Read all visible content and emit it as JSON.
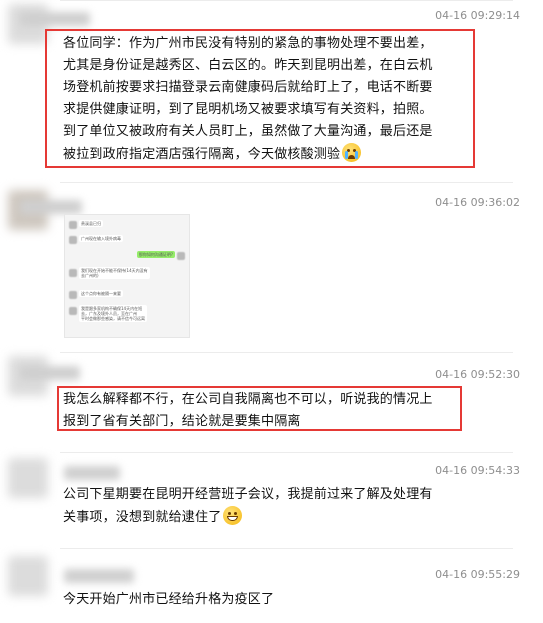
{
  "colors": {
    "highlight_border": "#e53935",
    "timestamp": "#8e8e8e",
    "text": "#111111"
  },
  "messages": [
    {
      "time": "04-16 09:29:14",
      "lines": [
        "各位同学：作为广州市民没有特别的紧急的事物处理不要出差，",
        "尤其是身份证是越秀区、白云区的。昨天到昆明出差，在白云机",
        "场登机前按要求扫描登录云南健康码后就给盯上了，电话不断要",
        "求提供健康证明，到了昆明机场又被要求填写有关资料，拍照。",
        "到了单位又被政府有关人员盯上，虽然做了大量沟通，最后还是",
        "被拉到政府指定酒店强行隔离，今天做核酸测验"
      ],
      "emoji": "crying-face-icon"
    },
    {
      "time": "04-16 09:36:02",
      "image": {
        "bubbles": [
          "贵溪县已归",
          "广州现在输入境外病毒",
          "那你如何沟通证明?",
          "我们现在开始不能不保持(14天内没有",
          "去广州的)",
          "这个点你有被隔一来要",
          "我是跟多家机构不确保14天内在短",
          "去，广东及境外人员，至在广州",
          "平时会做那些感染，请不信今可远离"
        ]
      }
    },
    {
      "time": "04-16 09:52:30",
      "lines": [
        "我怎么解释都不行，在公司自我隔离也不可以，听说我的情况上",
        "报到了省有关部门，结论就是要集中隔离"
      ]
    },
    {
      "time": "04-16 09:54:33",
      "lines": [
        "公司下星期要在昆明开经营班子会议，我提前过来了解及处理有",
        "关事项，没想到就给逮住了"
      ],
      "emoji": "grinning-face-icon"
    },
    {
      "time": "04-16 09:55:29",
      "lines": [
        "今天开始广州市已经给升格为疫区了"
      ]
    }
  ]
}
